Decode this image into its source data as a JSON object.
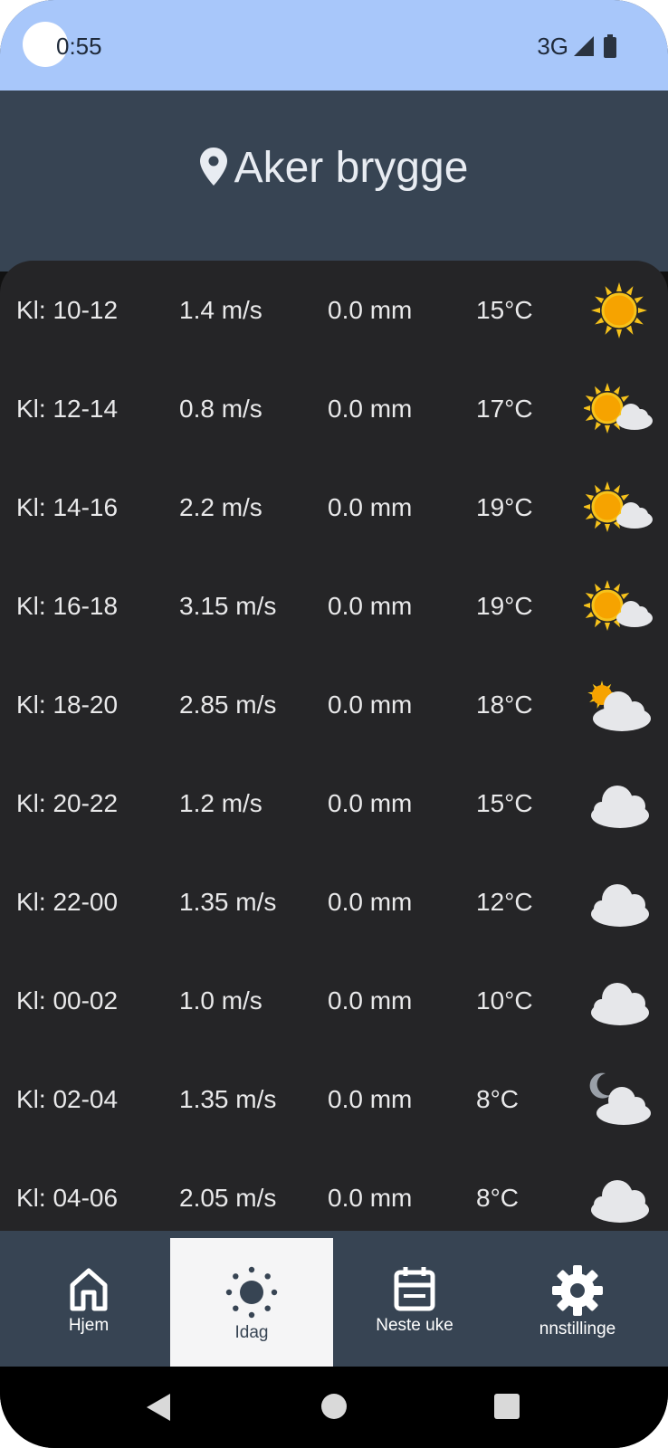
{
  "status_bar": {
    "time": "0:55",
    "network": "3G"
  },
  "header": {
    "location": "Aker brygge"
  },
  "forecast": [
    {
      "period": "Kl: 10-12",
      "wind": "1.4 m/s",
      "rain": "0.0 mm",
      "temp": "15°C",
      "icon": "sun"
    },
    {
      "period": "Kl: 12-14",
      "wind": "0.8 m/s",
      "rain": "0.0 mm",
      "temp": "17°C",
      "icon": "sun-cloud"
    },
    {
      "period": "Kl: 14-16",
      "wind": "2.2 m/s",
      "rain": "0.0 mm",
      "temp": "19°C",
      "icon": "sun-cloud"
    },
    {
      "period": "Kl: 16-18",
      "wind": "3.15 m/s",
      "rain": "0.0 mm",
      "temp": "19°C",
      "icon": "sun-cloud"
    },
    {
      "period": "Kl: 18-20",
      "wind": "2.85 m/s",
      "rain": "0.0 mm",
      "temp": "18°C",
      "icon": "cloud-sun"
    },
    {
      "period": "Kl: 20-22",
      "wind": "1.2 m/s",
      "rain": "0.0 mm",
      "temp": "15°C",
      "icon": "cloud"
    },
    {
      "period": "Kl: 22-00",
      "wind": "1.35 m/s",
      "rain": "0.0 mm",
      "temp": "12°C",
      "icon": "cloud"
    },
    {
      "period": "Kl: 00-02",
      "wind": "1.0 m/s",
      "rain": "0.0 mm",
      "temp": "10°C",
      "icon": "cloud"
    },
    {
      "period": "Kl: 02-04",
      "wind": "1.35 m/s",
      "rain": "0.0 mm",
      "temp": "8°C",
      "icon": "moon-cloud"
    },
    {
      "period": "Kl: 04-06",
      "wind": "2.05 m/s",
      "rain": "0.0 mm",
      "temp": "8°C",
      "icon": "cloud"
    }
  ],
  "nav": {
    "items": [
      {
        "label": "Hjem",
        "icon": "home-icon",
        "active": false
      },
      {
        "label": "Idag",
        "icon": "sun-icon",
        "active": true
      },
      {
        "label": "Neste uke",
        "icon": "calendar-icon",
        "active": false
      },
      {
        "label": "nnstillinge",
        "icon": "gear-icon",
        "active": false
      }
    ]
  },
  "colors": {
    "status_bar": "#a8c7fa",
    "header": "#374453",
    "panel": "#252527",
    "active_tab": "#f5f5f6"
  }
}
